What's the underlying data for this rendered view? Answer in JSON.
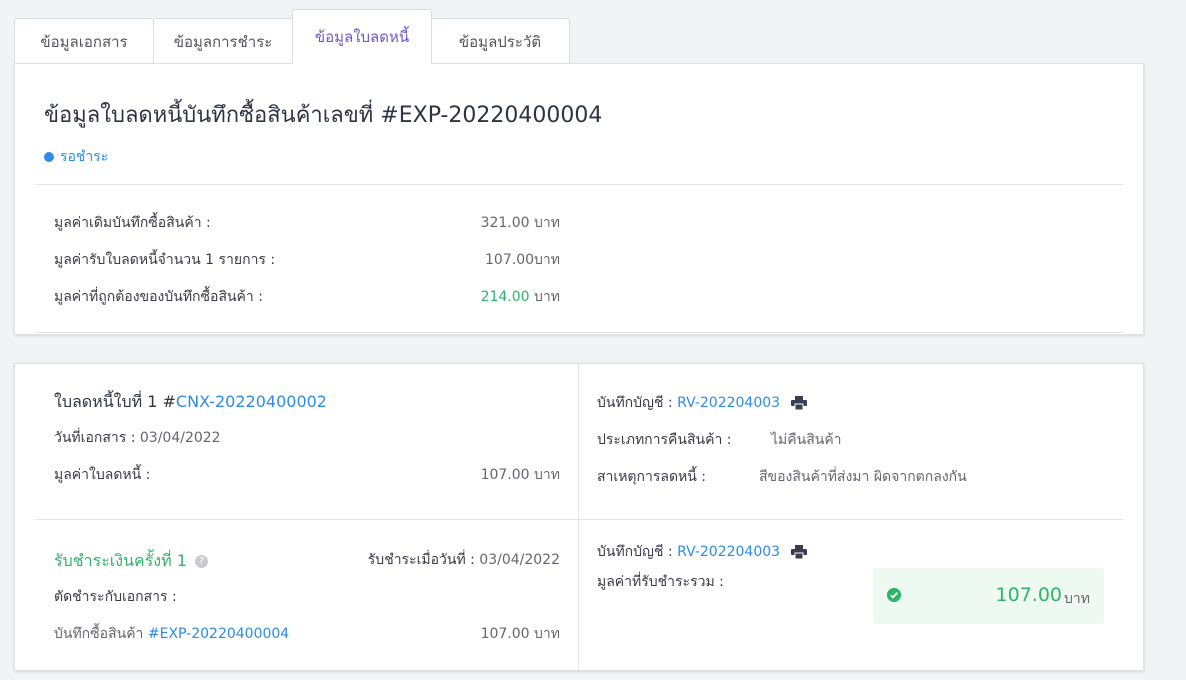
{
  "tabs": [
    {
      "label": "ข้อมูลเอกสาร"
    },
    {
      "label": "ข้อมูลการชำระ"
    },
    {
      "label": "ข้อมูลใบลดหนี้"
    },
    {
      "label": "ข้อมูลประวัติ"
    }
  ],
  "summary": {
    "title": "ข้อมูลใบลดหนี้บันทึกซื้อสินค้าเลขที่ #EXP-20220400004",
    "status": "รอชำระ",
    "rows": [
      {
        "label": "มูลค่าเดิมบันทึกซื้อสินค้า :",
        "value": "321.00",
        "unit": " บาท"
      },
      {
        "label": "มูลค่ารับใบลดหนี้จำนวน 1 รายการ :",
        "value": "107.00",
        "unit": "บาท"
      },
      {
        "label": "มูลค่าที่ถูกต้องของบันทึกซื้อสินค้า :",
        "value": "214.00",
        "unit": " บาท"
      }
    ]
  },
  "credit_note": {
    "heading_prefix": "ใบลดหนี้ใบที่ 1 #",
    "number": "CNX-20220400002",
    "date_label": "วันที่เอกสาร :",
    "date_value": " 03/04/2022",
    "amount_label": "มูลค่าใบลดหนี้ :",
    "amount_value": "107.00 บาท",
    "account_label": "บันทึกบัญชี :",
    "account_value": "RV-202204003",
    "return_type_label": "ประเภทการคืนสินค้า :",
    "return_type_value": "ไม่คืนสินค้า",
    "reason_label": "สาเหตุการลดหนี้ :",
    "reason_value": "สีของสินค้าที่ส่งมา ผิดจากตกลงกัน"
  },
  "payment": {
    "heading": "รับชำระเงินครั้งที่ 1",
    "date_label": "รับชำระเมื่อวันที่ :",
    "date_value": " 03/04/2022",
    "deduct_label": "ตัดชำระกับเอกสาร :",
    "doc_prefix": "บันทึกซื้อสินค้า ",
    "doc_number": "#EXP-20220400004",
    "doc_amount": "107.00 บาท",
    "account_label": "บันทึกบัญชี :",
    "account_value": "RV-202204003",
    "total_label": "มูลค่าที่รับชำระรวม :",
    "total_value": "107.00",
    "total_unit": "บาท"
  },
  "colors": {
    "accent": "#6f58c9",
    "link": "#2d8ce8",
    "success": "#2fb56a"
  }
}
